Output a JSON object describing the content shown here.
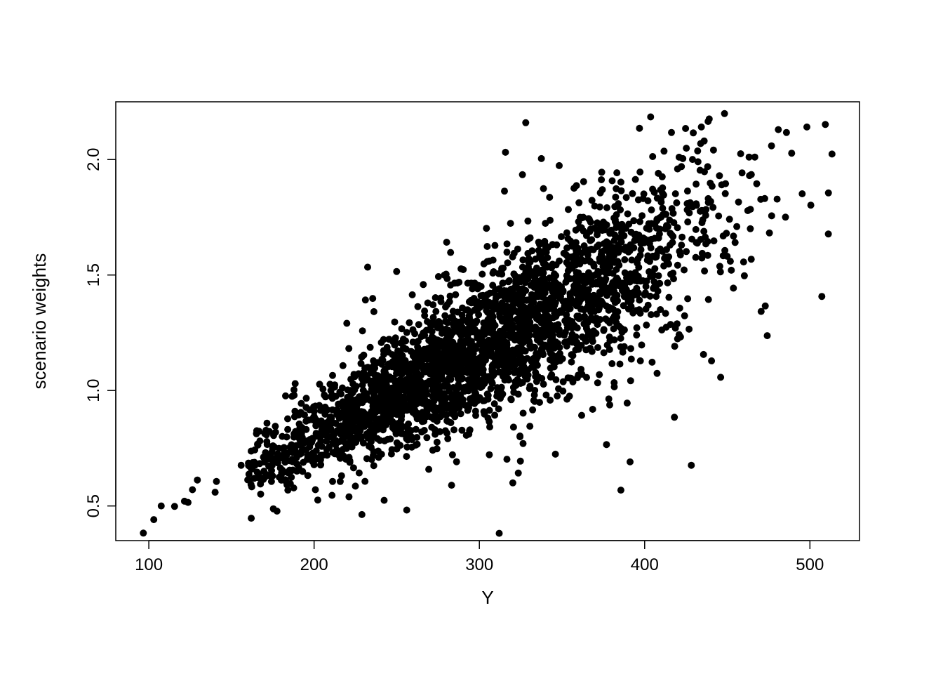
{
  "chart_data": {
    "type": "scatter",
    "title": "",
    "xlabel": "Y",
    "ylabel": "scenario weights",
    "xlim": [
      80,
      530
    ],
    "ylim": [
      0.35,
      2.25
    ],
    "xticks": [
      100,
      200,
      300,
      400,
      500
    ],
    "yticks": [
      0.5,
      1.0,
      1.5,
      2.0
    ],
    "n_points": 3000,
    "point_color": "#000000",
    "point_radius_px": 5,
    "distribution_note": "Dense scatter cloud, positive monotone trend from roughly (100,0.45) to (520,2.1). Bulk of mass between x 180-400 and y 0.55-1.5. Variance in y increases with x. No grid lines; base-R style box plot with inward ticks, open circles rendered solid.",
    "seed": 20240611
  }
}
